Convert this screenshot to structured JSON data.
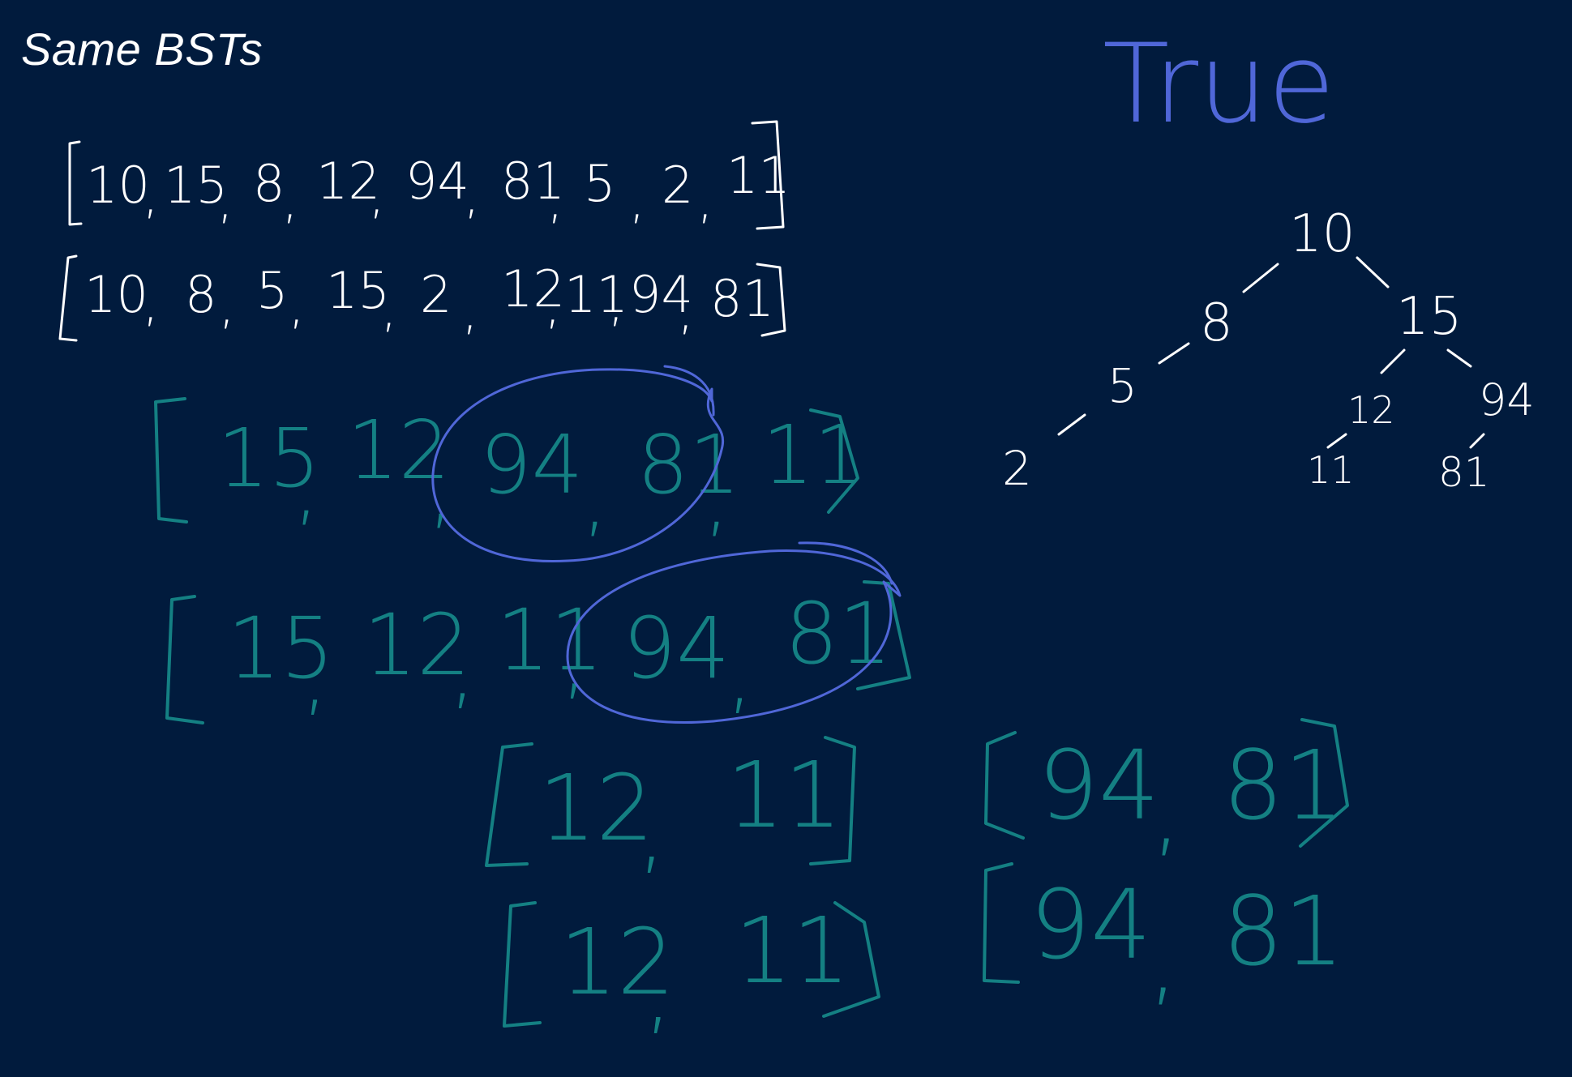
{
  "title": "Same BSTs",
  "result": "True",
  "arrays": {
    "array_one": [
      "10",
      "15",
      "8",
      "12",
      "94",
      "81",
      "5",
      "2",
      "11"
    ],
    "array_two": [
      "10",
      "8",
      "5",
      "15",
      "2",
      "12",
      "11",
      "94",
      "81"
    ]
  },
  "work": {
    "right_one": [
      "15",
      "12",
      "94",
      "81",
      "11"
    ],
    "right_two": [
      "15",
      "12",
      "11",
      "94",
      "81"
    ],
    "left_sub_one": [
      "12",
      "11"
    ],
    "left_sub_two": [
      "12",
      "11"
    ],
    "right_sub_one": [
      "94",
      "81"
    ],
    "right_sub_two": [
      "94",
      "81"
    ]
  },
  "tree": {
    "root": "10",
    "n8": "8",
    "n5": "5",
    "n2": "2",
    "n15": "15",
    "n12": "12",
    "n94": "94",
    "n11": "11",
    "n81": "81"
  },
  "colors": {
    "background": "#011b3d",
    "white_ink": "#ffffff",
    "teal_ink": "#148083",
    "blue_ink": "#5067d8"
  }
}
